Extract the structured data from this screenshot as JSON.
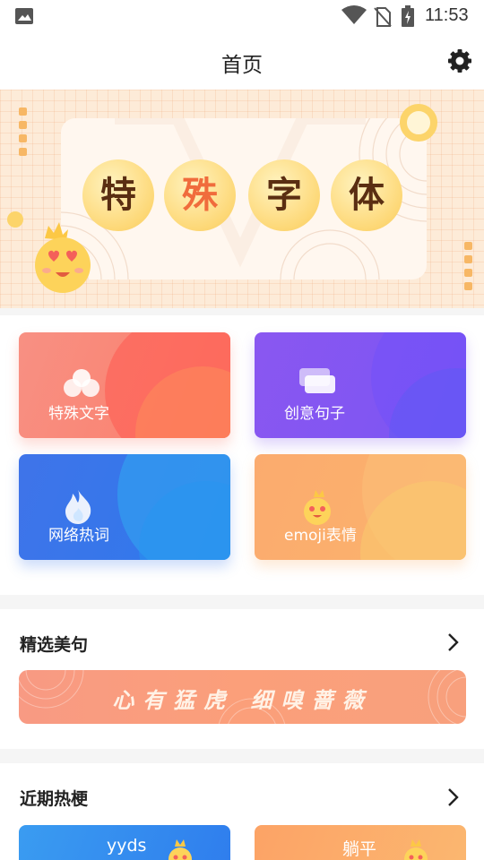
{
  "status_bar": {
    "time": "11:53",
    "icons": [
      "image-icon",
      "wifi-icon",
      "no-sim-icon",
      "battery-icon"
    ]
  },
  "header": {
    "title": "首页",
    "settings_icon": "gear-icon"
  },
  "banner": {
    "characters": [
      "特",
      "殊",
      "字",
      "体"
    ],
    "colors": {
      "background": "#fdebd8",
      "accent": "#fcd46a",
      "text": "#5a2e12",
      "highlight": "#f06c3c"
    }
  },
  "features": [
    {
      "label": "特殊文字",
      "icon": "bubbles-icon",
      "color": "#f98a7a"
    },
    {
      "label": "创意句子",
      "icon": "cards-icon",
      "color": "#8057f1"
    },
    {
      "label": "网络热词",
      "icon": "fire-icon",
      "color": "#3a76ea"
    },
    {
      "label": "emoji表情",
      "icon": "emoji-icon",
      "color": "#fbae6e"
    }
  ],
  "selected_quotes": {
    "title": "精选美句",
    "quote": "心有猛虎 细嗅蔷薇"
  },
  "recent_hot": {
    "title": "近期热梗",
    "items": [
      {
        "label": "yyds",
        "color": "#3490ef"
      },
      {
        "label": "躺平",
        "color": "#fcac6a"
      }
    ]
  }
}
